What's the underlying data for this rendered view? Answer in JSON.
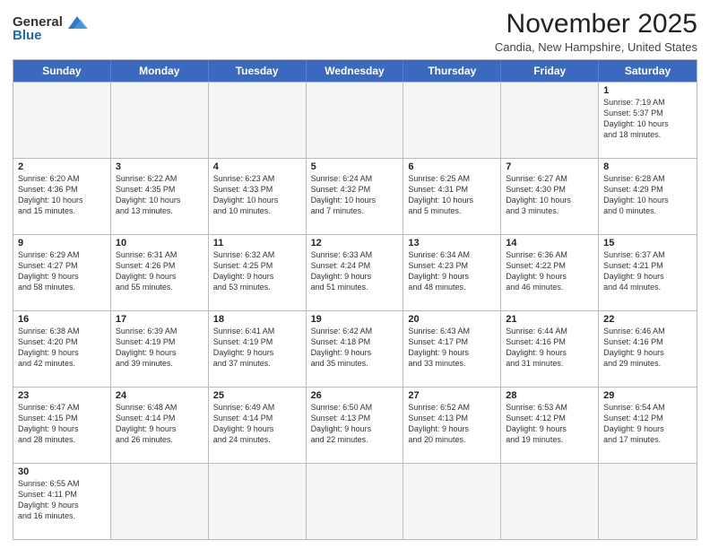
{
  "logo": {
    "text_general": "General",
    "text_blue": "Blue"
  },
  "title": "November 2025",
  "subtitle": "Candia, New Hampshire, United States",
  "headers": [
    "Sunday",
    "Monday",
    "Tuesday",
    "Wednesday",
    "Thursday",
    "Friday",
    "Saturday"
  ],
  "weeks": [
    [
      {
        "date": "",
        "info": ""
      },
      {
        "date": "",
        "info": ""
      },
      {
        "date": "",
        "info": ""
      },
      {
        "date": "",
        "info": ""
      },
      {
        "date": "",
        "info": ""
      },
      {
        "date": "",
        "info": ""
      },
      {
        "date": "1",
        "info": "Sunrise: 7:19 AM\nSunset: 5:37 PM\nDaylight: 10 hours\nand 18 minutes."
      }
    ],
    [
      {
        "date": "2",
        "info": "Sunrise: 6:20 AM\nSunset: 4:36 PM\nDaylight: 10 hours\nand 15 minutes."
      },
      {
        "date": "3",
        "info": "Sunrise: 6:22 AM\nSunset: 4:35 PM\nDaylight: 10 hours\nand 13 minutes."
      },
      {
        "date": "4",
        "info": "Sunrise: 6:23 AM\nSunset: 4:33 PM\nDaylight: 10 hours\nand 10 minutes."
      },
      {
        "date": "5",
        "info": "Sunrise: 6:24 AM\nSunset: 4:32 PM\nDaylight: 10 hours\nand 7 minutes."
      },
      {
        "date": "6",
        "info": "Sunrise: 6:25 AM\nSunset: 4:31 PM\nDaylight: 10 hours\nand 5 minutes."
      },
      {
        "date": "7",
        "info": "Sunrise: 6:27 AM\nSunset: 4:30 PM\nDaylight: 10 hours\nand 3 minutes."
      },
      {
        "date": "8",
        "info": "Sunrise: 6:28 AM\nSunset: 4:29 PM\nDaylight: 10 hours\nand 0 minutes."
      }
    ],
    [
      {
        "date": "9",
        "info": "Sunrise: 6:29 AM\nSunset: 4:27 PM\nDaylight: 9 hours\nand 58 minutes."
      },
      {
        "date": "10",
        "info": "Sunrise: 6:31 AM\nSunset: 4:26 PM\nDaylight: 9 hours\nand 55 minutes."
      },
      {
        "date": "11",
        "info": "Sunrise: 6:32 AM\nSunset: 4:25 PM\nDaylight: 9 hours\nand 53 minutes."
      },
      {
        "date": "12",
        "info": "Sunrise: 6:33 AM\nSunset: 4:24 PM\nDaylight: 9 hours\nand 51 minutes."
      },
      {
        "date": "13",
        "info": "Sunrise: 6:34 AM\nSunset: 4:23 PM\nDaylight: 9 hours\nand 48 minutes."
      },
      {
        "date": "14",
        "info": "Sunrise: 6:36 AM\nSunset: 4:22 PM\nDaylight: 9 hours\nand 46 minutes."
      },
      {
        "date": "15",
        "info": "Sunrise: 6:37 AM\nSunset: 4:21 PM\nDaylight: 9 hours\nand 44 minutes."
      }
    ],
    [
      {
        "date": "16",
        "info": "Sunrise: 6:38 AM\nSunset: 4:20 PM\nDaylight: 9 hours\nand 42 minutes."
      },
      {
        "date": "17",
        "info": "Sunrise: 6:39 AM\nSunset: 4:19 PM\nDaylight: 9 hours\nand 39 minutes."
      },
      {
        "date": "18",
        "info": "Sunrise: 6:41 AM\nSunset: 4:19 PM\nDaylight: 9 hours\nand 37 minutes."
      },
      {
        "date": "19",
        "info": "Sunrise: 6:42 AM\nSunset: 4:18 PM\nDaylight: 9 hours\nand 35 minutes."
      },
      {
        "date": "20",
        "info": "Sunrise: 6:43 AM\nSunset: 4:17 PM\nDaylight: 9 hours\nand 33 minutes."
      },
      {
        "date": "21",
        "info": "Sunrise: 6:44 AM\nSunset: 4:16 PM\nDaylight: 9 hours\nand 31 minutes."
      },
      {
        "date": "22",
        "info": "Sunrise: 6:46 AM\nSunset: 4:16 PM\nDaylight: 9 hours\nand 29 minutes."
      }
    ],
    [
      {
        "date": "23",
        "info": "Sunrise: 6:47 AM\nSunset: 4:15 PM\nDaylight: 9 hours\nand 28 minutes."
      },
      {
        "date": "24",
        "info": "Sunrise: 6:48 AM\nSunset: 4:14 PM\nDaylight: 9 hours\nand 26 minutes."
      },
      {
        "date": "25",
        "info": "Sunrise: 6:49 AM\nSunset: 4:14 PM\nDaylight: 9 hours\nand 24 minutes."
      },
      {
        "date": "26",
        "info": "Sunrise: 6:50 AM\nSunset: 4:13 PM\nDaylight: 9 hours\nand 22 minutes."
      },
      {
        "date": "27",
        "info": "Sunrise: 6:52 AM\nSunset: 4:13 PM\nDaylight: 9 hours\nand 20 minutes."
      },
      {
        "date": "28",
        "info": "Sunrise: 6:53 AM\nSunset: 4:12 PM\nDaylight: 9 hours\nand 19 minutes."
      },
      {
        "date": "29",
        "info": "Sunrise: 6:54 AM\nSunset: 4:12 PM\nDaylight: 9 hours\nand 17 minutes."
      }
    ],
    [
      {
        "date": "30",
        "info": "Sunrise: 6:55 AM\nSunset: 4:11 PM\nDaylight: 9 hours\nand 16 minutes."
      },
      {
        "date": "",
        "info": ""
      },
      {
        "date": "",
        "info": ""
      },
      {
        "date": "",
        "info": ""
      },
      {
        "date": "",
        "info": ""
      },
      {
        "date": "",
        "info": ""
      },
      {
        "date": "",
        "info": ""
      }
    ]
  ]
}
